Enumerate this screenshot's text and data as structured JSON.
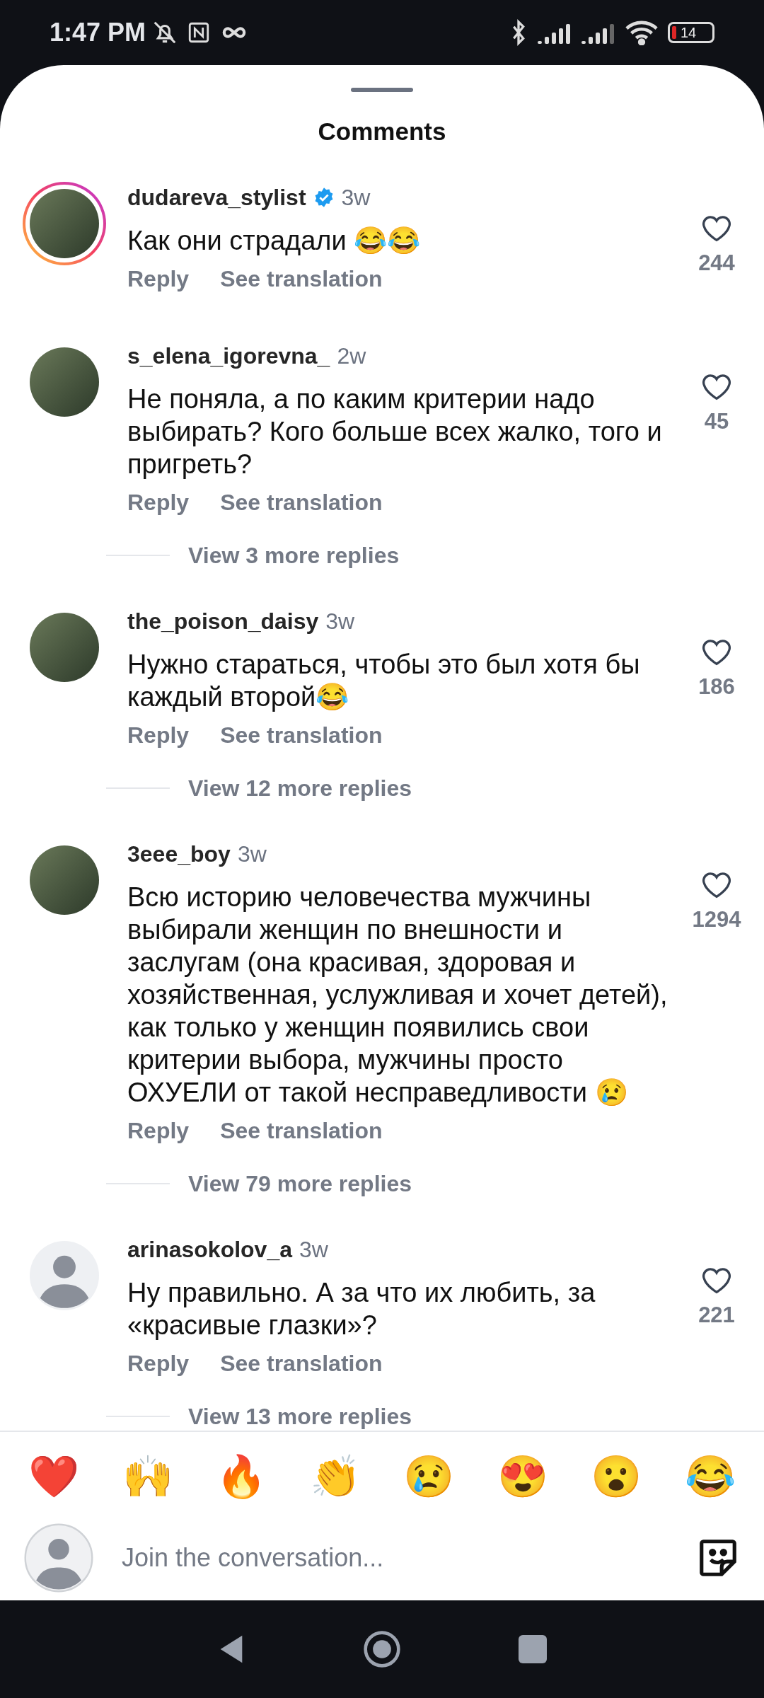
{
  "status_bar": {
    "time": "1:47 PM",
    "battery": "14"
  },
  "sheet": {
    "title": "Comments"
  },
  "comments": [
    {
      "username": "dudareva_stylist",
      "verified": true,
      "age": "3w",
      "kind": "photo",
      "story_ring": true,
      "text": "Как они страдали 😂😂",
      "actions": [
        "Reply",
        "See translation"
      ],
      "likes": "244",
      "liked": false
    },
    {
      "username": "s_elena_igorevna_",
      "verified": false,
      "age": "2w",
      "kind": "photo",
      "story_ring": false,
      "text": "Не поняла, а по каким критерии надо выбирать? Кого больше всех жалко, того и пригреть?",
      "actions": [
        "Reply",
        "See translation"
      ],
      "likes": "45",
      "liked": false,
      "replies": "View 3 more replies"
    },
    {
      "username": "the_poison_daisy",
      "verified": false,
      "age": "3w",
      "kind": "photo",
      "story_ring": false,
      "text": "Нужно стараться, чтобы это был хотя бы каждый второй😂",
      "actions": [
        "Reply",
        "See translation"
      ],
      "likes": "186",
      "liked": false,
      "replies": "View 12 more replies"
    },
    {
      "username": "3eee_boy",
      "verified": false,
      "age": "3w",
      "kind": "photo",
      "story_ring": false,
      "text": "Всю историю человечества мужчины выбирали женщин по внешности и заслугам (она красивая, здоровая и хозяйственная, услужливая и хочет детей), как только у женщин появились свои критерии выбора, мужчины просто ОХУЕЛИ от такой несправедливости 😢",
      "actions": [
        "Reply",
        "See translation"
      ],
      "likes": "1294",
      "liked": false,
      "replies": "View 79 more replies"
    },
    {
      "username": "arinasokolov_a",
      "verified": false,
      "age": "3w",
      "kind": "default",
      "story_ring": false,
      "text": "Ну правильно. А за что их любить, за «красивые глазки»?",
      "actions": [
        "Reply",
        "See translation"
      ],
      "likes": "221",
      "liked": false,
      "replies": "View 13 more replies"
    }
  ],
  "reactions": [
    "❤️",
    "🙌",
    "🔥",
    "👏",
    "😢",
    "😍",
    "😮",
    "😂"
  ],
  "composer": {
    "placeholder": "Join the conversation..."
  }
}
